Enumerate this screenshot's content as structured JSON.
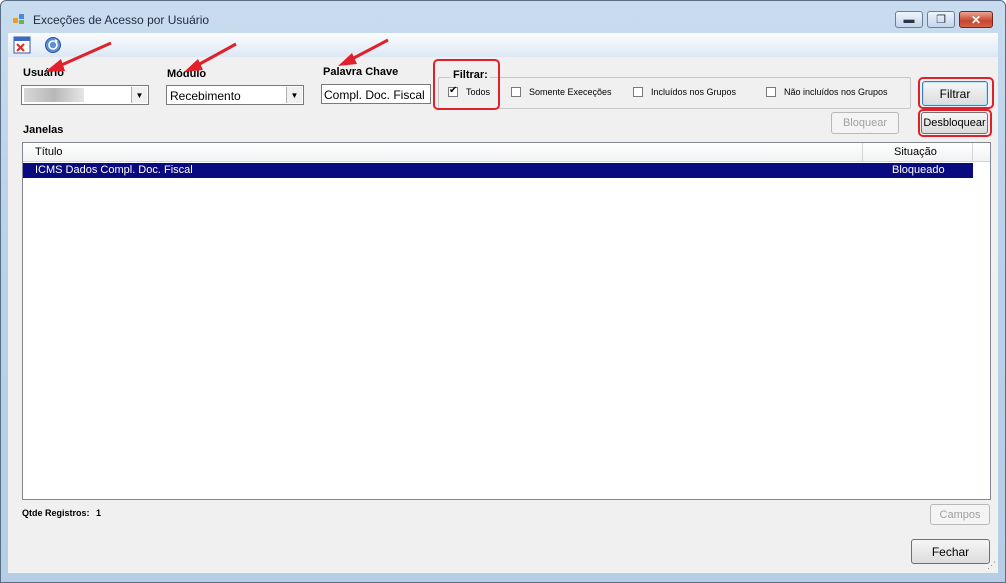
{
  "window": {
    "title": "Exceções de Acesso por Usuário",
    "controls": {
      "minimize": "▬",
      "maximize": "❐",
      "close": "✕"
    }
  },
  "toolbar": {
    "buttons": [
      {
        "name": "close-form-icon",
        "color": "#d9342b"
      },
      {
        "name": "refresh-icon",
        "color": "#2d62c0"
      }
    ]
  },
  "form": {
    "usuario_label": "Usuário",
    "usuario_value": "",
    "modulo_label": "Módulo",
    "modulo_value": "Recebimento",
    "palavra_chave_label": "Palavra Chave",
    "palavra_chave_value": "Compl. Doc. Fiscal",
    "filtrar_group_label": "Filtrar:",
    "filter_options": [
      {
        "label": "Todos",
        "checked": true
      },
      {
        "label": "Somente Execeções",
        "checked": false
      },
      {
        "label": "Incluídos nos Grupos",
        "checked": false
      },
      {
        "label": "Não incluídos nos Grupos",
        "checked": false
      }
    ],
    "filtrar_button": "Filtrar",
    "bloquear_button": "Bloquear",
    "desbloquear_button": "Desbloquear",
    "janelas_label": "Janelas"
  },
  "grid": {
    "columns": [
      "Título",
      "Situação"
    ],
    "rows": [
      {
        "titulo": "ICMS Dados Compl. Doc. Fiscal",
        "situacao": "Bloqueado"
      }
    ]
  },
  "footer": {
    "qtde_label": "Qtde Registros:",
    "qtde_value": "1",
    "campos_button": "Campos",
    "fechar_button": "Fechar"
  },
  "colors": {
    "selection": "#0a0a80",
    "highlight": "#e0202a"
  }
}
